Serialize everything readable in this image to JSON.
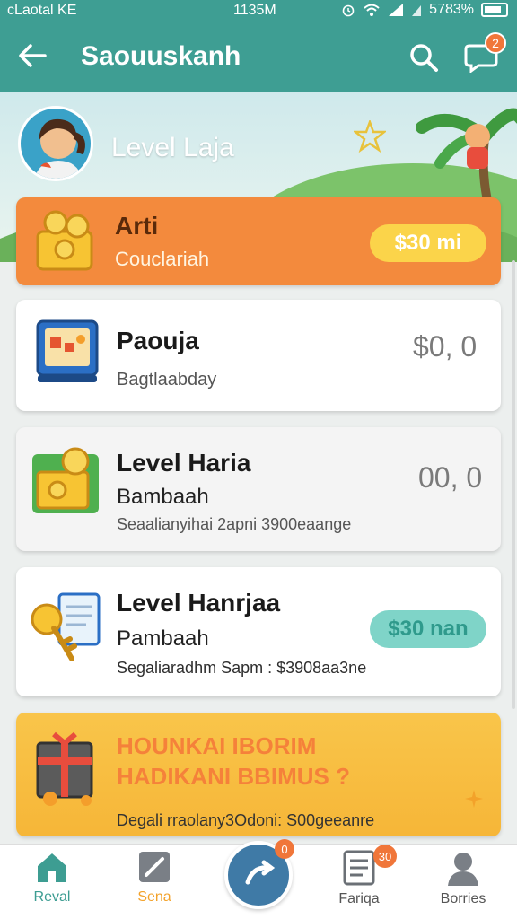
{
  "status_bar": {
    "carrier": "cLaotal KE",
    "time": "1135M",
    "battery": "5783%"
  },
  "app_bar": {
    "title": "Saouuskanh",
    "notification_count": "2"
  },
  "hero": {
    "level_label": "Level Laja"
  },
  "reward_card": {
    "title": "Arti",
    "subtitle": "Couclariah",
    "button": "$30 mi"
  },
  "task_cards": [
    {
      "title": "Paouja",
      "subtitle": "Bagtlaabday",
      "amount": "$0, 0"
    },
    {
      "title": "Level Haria",
      "subtitle": "Bambaah",
      "detail": "Seaalianyihai 2apni 3900eaange",
      "amount": "00, 0"
    },
    {
      "title": "Level Hanrjaa",
      "subtitle": "Pambaah",
      "detail": "Segaliaradhm Sapm : $3908aa3ne",
      "button": "$30 nan"
    }
  ],
  "promo": {
    "line1": "HOUNKAI IBORIM",
    "line2": "HADIKANI BBIMUS ?",
    "detail": "Degali rraolany3Odoni: S00geeanre"
  },
  "bottom_nav": {
    "items": [
      {
        "label": "Reval"
      },
      {
        "label": "Sena"
      },
      {
        "label": "Fariqa",
        "badge": "30"
      },
      {
        "label": "Borries"
      }
    ],
    "center_badge": "0"
  },
  "colors": {
    "teal": "#3e9e93",
    "orange": "#f38a3d",
    "yellow": "#f6b638",
    "mint": "#7fd4c8"
  }
}
